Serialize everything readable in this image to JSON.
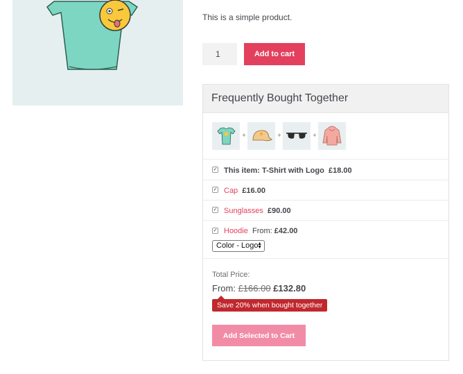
{
  "product": {
    "short_description": "This is a simple product.",
    "quantity": "1",
    "add_to_cart_label": "Add to cart"
  },
  "fbt": {
    "title": "Frequently Bought Together",
    "plus_sign": "+",
    "items": [
      {
        "prefix": "This item: T-Shirt with Logo",
        "name": "",
        "from": "",
        "price": "£18.00",
        "checked": true,
        "icon": "tshirt-icon"
      },
      {
        "prefix": "",
        "name": "Cap",
        "from": "",
        "price": "£16.00",
        "checked": true,
        "icon": "cap-icon"
      },
      {
        "prefix": "",
        "name": "Sunglasses",
        "from": "",
        "price": "£90.00",
        "checked": true,
        "icon": "sunglasses-icon"
      },
      {
        "prefix": "",
        "name": "Hoodie",
        "from": "From:",
        "price": "£42.00",
        "checked": true,
        "icon": "hoodie-icon"
      }
    ],
    "variation_select": "Color - Logo",
    "total_label": "Total Price:",
    "total_from": "From:",
    "total_original": "£166.00",
    "total_discounted": "£132.80",
    "save_badge": "Save 20% when bought together",
    "add_selected_label": "Add Selected to Cart"
  },
  "colors": {
    "accent": "#e3405d",
    "badge": "#c0282e",
    "button_disabled": "#f28ca6"
  }
}
